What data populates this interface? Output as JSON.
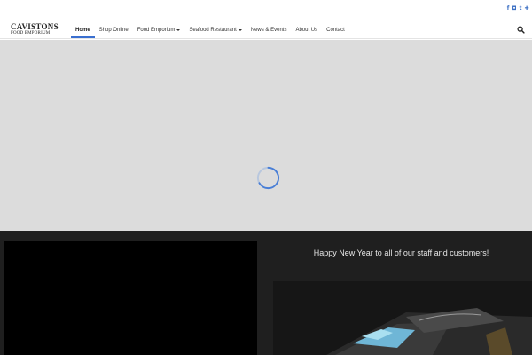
{
  "brand": {
    "logo_line1": "CAVISTONS",
    "logo_line2": "FOOD EMPORIUM",
    "accent_color": "#3a6fd0"
  },
  "social": [
    {
      "icon": "facebook-icon",
      "glyph": "f"
    },
    {
      "icon": "instagram-icon",
      "glyph": "◘"
    },
    {
      "icon": "twitter-icon",
      "glyph": "t"
    },
    {
      "icon": "share-icon",
      "glyph": "✚"
    }
  ],
  "nav": {
    "items": [
      {
        "label": "Home",
        "active": true,
        "dropdown": false
      },
      {
        "label": "Shop Online",
        "active": false,
        "dropdown": false
      },
      {
        "label": "Food Emporium",
        "active": false,
        "dropdown": true
      },
      {
        "label": "Seafood Restaurant",
        "active": false,
        "dropdown": true
      },
      {
        "label": "News & Events",
        "active": false,
        "dropdown": false
      },
      {
        "label": "About Us",
        "active": false,
        "dropdown": false
      },
      {
        "label": "Contact",
        "active": false,
        "dropdown": false
      }
    ],
    "search_icon": "search-icon"
  },
  "hero": {
    "state_icon": "loading-spinner-icon",
    "background": "#dcdcdc"
  },
  "news": {
    "title": "Happy New Year to all of our staff and customers!"
  }
}
